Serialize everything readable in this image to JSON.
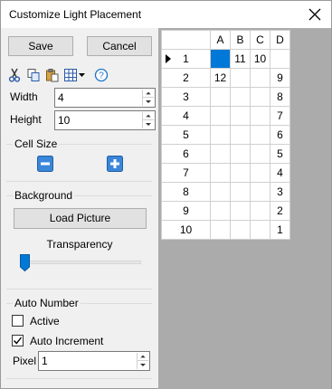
{
  "window": {
    "title": "Customize Light Placement"
  },
  "actions": {
    "save_label": "Save",
    "cancel_label": "Cancel"
  },
  "toolbar": {
    "icons": [
      "scissors-icon",
      "copy-icon",
      "paste-icon",
      "grid-icon",
      "help-icon"
    ]
  },
  "size": {
    "width_label": "Width",
    "width_value": "4",
    "height_label": "Height",
    "height_value": "10"
  },
  "cell_size": {
    "label": "Cell Size"
  },
  "background": {
    "label": "Background",
    "load_label": "Load Picture",
    "transparency_label": "Transparency",
    "transparency_value": 0
  },
  "auto_number": {
    "label": "Auto Number",
    "active_label": "Active",
    "active_checked": false,
    "increment_label": "Auto Increment",
    "increment_checked": true,
    "pixel_label": "Pixel",
    "pixel_value": "1"
  },
  "grid": {
    "columns": [
      "A",
      "B",
      "C",
      "D"
    ],
    "current_row": "1",
    "selected_cell": "A1",
    "rows": [
      {
        "label": "1",
        "cells": [
          "",
          "11",
          "10",
          ""
        ]
      },
      {
        "label": "2",
        "cells": [
          "12",
          "",
          "",
          "9"
        ]
      },
      {
        "label": "3",
        "cells": [
          "",
          "",
          "",
          "8"
        ]
      },
      {
        "label": "4",
        "cells": [
          "",
          "",
          "",
          "7"
        ]
      },
      {
        "label": "5",
        "cells": [
          "",
          "",
          "",
          "6"
        ]
      },
      {
        "label": "6",
        "cells": [
          "",
          "",
          "",
          "5"
        ]
      },
      {
        "label": "7",
        "cells": [
          "",
          "",
          "",
          "4"
        ]
      },
      {
        "label": "8",
        "cells": [
          "",
          "",
          "",
          "3"
        ]
      },
      {
        "label": "9",
        "cells": [
          "",
          "",
          "",
          "2"
        ]
      },
      {
        "label": "10",
        "cells": [
          "",
          "",
          "",
          "1"
        ]
      }
    ]
  },
  "colors": {
    "selection": "#0078d7",
    "grid_background": "#ababab",
    "icon_blue": "#1a73c9"
  }
}
